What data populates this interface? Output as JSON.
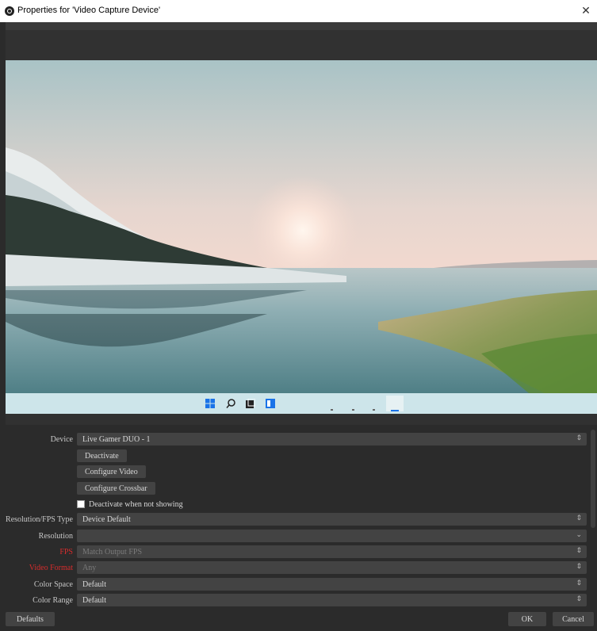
{
  "window": {
    "title": "Properties for 'Video Capture Device'",
    "close_glyph": "✕"
  },
  "taskbar": {
    "icons": [
      "windows-start-icon",
      "search-icon",
      "task-view-icon",
      "widgets-icon"
    ]
  },
  "properties": {
    "device": {
      "label": "Device",
      "value": "Live Gamer DUO - 1"
    },
    "buttons": {
      "deactivate": "Deactivate",
      "configure_video": "Configure Video",
      "configure_crossbar": "Configure Crossbar"
    },
    "deactivate_when_not_showing": {
      "label": "Deactivate when not showing",
      "checked": false
    },
    "resolution_fps_type": {
      "label": "Resolution/FPS Type",
      "value": "Device Default"
    },
    "resolution": {
      "label": "Resolution",
      "value": ""
    },
    "fps": {
      "label": "FPS",
      "value": "Match Output FPS"
    },
    "video_format": {
      "label": "Video Format",
      "value": "Any"
    },
    "color_space": {
      "label": "Color Space",
      "value": "Default"
    },
    "color_range": {
      "label": "Color Range",
      "value": "Default"
    }
  },
  "footer": {
    "defaults": "Defaults",
    "ok": "OK",
    "cancel": "Cancel"
  },
  "colors": {
    "background": "#2b2b2b",
    "control": "#434343",
    "error_label": "#d62c2c"
  }
}
